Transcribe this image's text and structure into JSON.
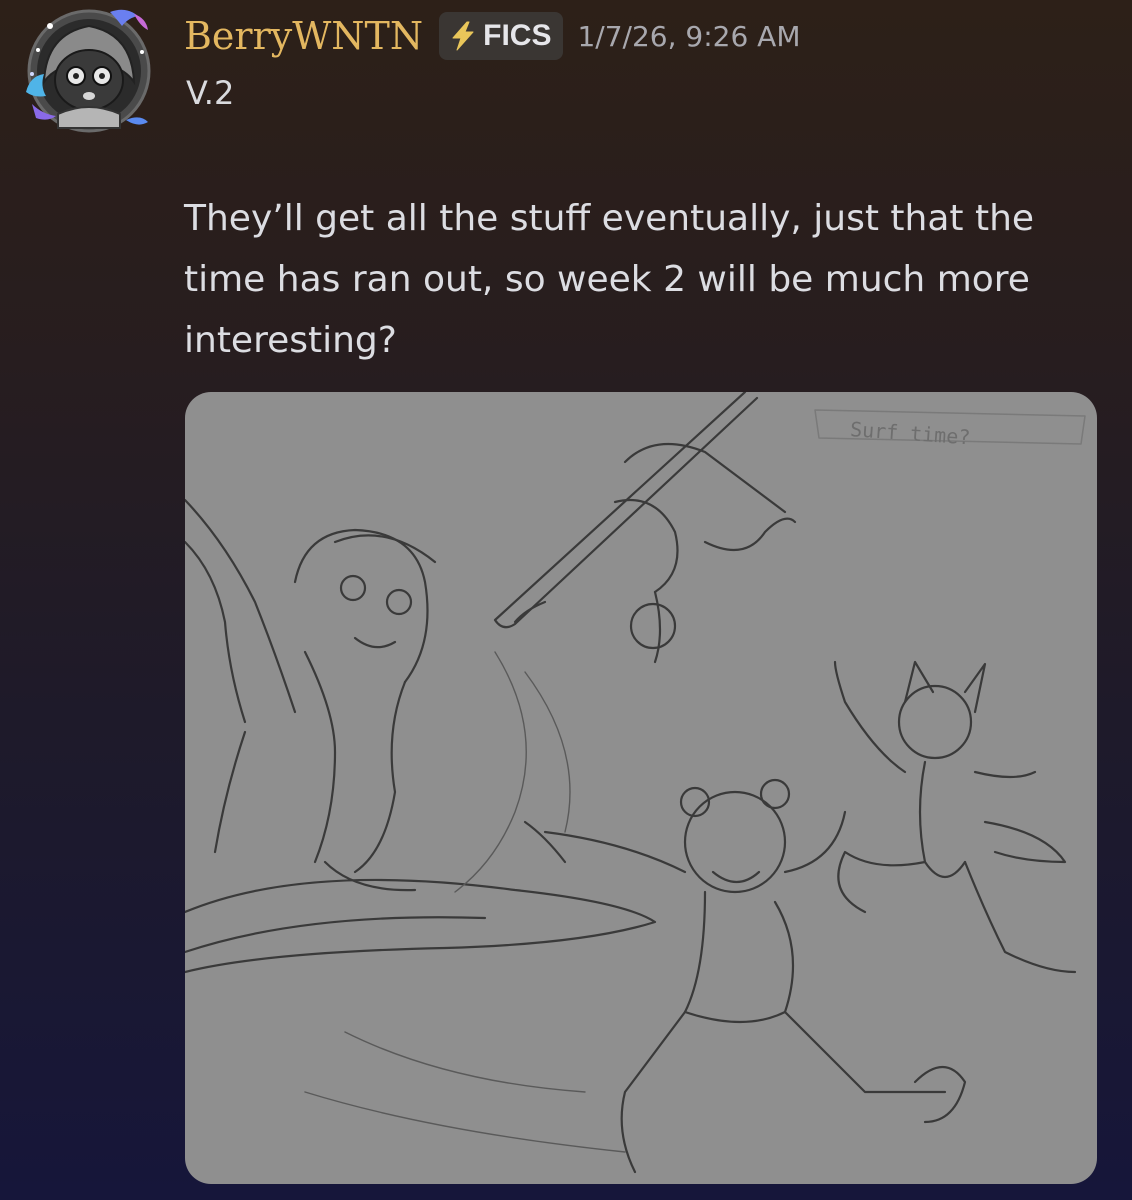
{
  "message": {
    "author": "BerryWNTN",
    "tag": {
      "icon": "lightning-bolt-icon",
      "label": "FICS"
    },
    "timestamp": "1/7/26, 9:26 AM",
    "subtitle": "V.2",
    "content": "They’ll get all the stuff eventually, just that the time has ran out, so week 2 will be much more interesting?",
    "attachment": {
      "kind": "sketch-image",
      "handwritten_note": "Surf time?"
    }
  },
  "colors": {
    "author": "#e3b760",
    "tag_background": "#3a3633",
    "tag_icon": "#e9c65a",
    "timestamp": "#a8a8ae",
    "text": "#dcdde2",
    "attachment_background": "#8f8f8f"
  }
}
